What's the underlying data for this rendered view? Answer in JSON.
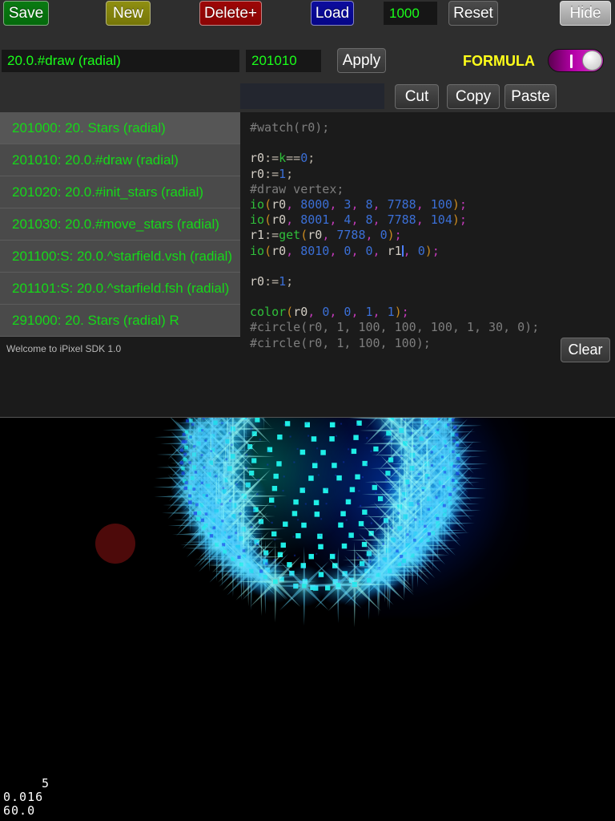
{
  "toolbar": {
    "save_label": "Save",
    "new_label": "New",
    "delete_label": "Delete+",
    "load_label": "Load",
    "count_value": "1000",
    "reset_label": "Reset",
    "hide_label": "Hide"
  },
  "edit_row": {
    "name_value": "20.0.#draw (radial)",
    "id_value": "201010",
    "apply_label": "Apply",
    "formula_label": "FORMULA",
    "formula_toggle_state": "on"
  },
  "clipboard_row": {
    "search_value": "",
    "search_placeholder": "",
    "cut_label": "Cut",
    "copy_label": "Copy",
    "paste_label": "Paste"
  },
  "list": {
    "items": [
      {
        "label": "201000: 20. Stars (radial)",
        "selected": true
      },
      {
        "label": "201010: 20.0.#draw (radial)",
        "selected": false
      },
      {
        "label": "201020: 20.0.#init_stars (radial)",
        "selected": false
      },
      {
        "label": "201030: 20.0.#move_stars (radial)",
        "selected": false
      },
      {
        "label": "201100:S: 20.0.^starfield.vsh (radial)",
        "selected": false
      },
      {
        "label": "201101:S: 20.0.^starfield.fsh (radial)",
        "selected": false
      },
      {
        "label": "291000: 20. Stars (radial) R",
        "selected": false
      }
    ]
  },
  "status": {
    "message": "Welcome to iPixel SDK 1.0",
    "clear_label": "Clear"
  },
  "editor": {
    "lines": [
      [
        {
          "t": "#watch(r0);",
          "c": "c-com"
        }
      ],
      [
        {
          "t": "",
          "c": "c-com"
        }
      ],
      [
        {
          "t": "r0",
          "c": "c-var"
        },
        {
          "t": ":=",
          "c": "c-op"
        },
        {
          "t": "k",
          "c": "c-fn"
        },
        {
          "t": "==",
          "c": "c-op"
        },
        {
          "t": "0",
          "c": "c-num"
        },
        {
          "t": ";",
          "c": "c-op"
        }
      ],
      [
        {
          "t": "r0",
          "c": "c-var"
        },
        {
          "t": ":=",
          "c": "c-op"
        },
        {
          "t": "1",
          "c": "c-num"
        },
        {
          "t": ";",
          "c": "c-op"
        }
      ],
      [
        {
          "t": "#draw vertex;",
          "c": "c-com"
        }
      ],
      [
        {
          "t": "io",
          "c": "c-fn"
        },
        {
          "t": "(",
          "c": "c-paren"
        },
        {
          "t": "r0",
          "c": "c-var"
        },
        {
          "t": ", ",
          "c": "c-comma"
        },
        {
          "t": "8000",
          "c": "c-num"
        },
        {
          "t": ", ",
          "c": "c-comma"
        },
        {
          "t": "3",
          "c": "c-num"
        },
        {
          "t": ", ",
          "c": "c-comma"
        },
        {
          "t": "8",
          "c": "c-num"
        },
        {
          "t": ", ",
          "c": "c-comma"
        },
        {
          "t": "7788",
          "c": "c-num"
        },
        {
          "t": ", ",
          "c": "c-comma"
        },
        {
          "t": "100",
          "c": "c-num"
        },
        {
          "t": ")",
          "c": "c-paren"
        },
        {
          "t": ";",
          "c": "c-comma"
        }
      ],
      [
        {
          "t": "io",
          "c": "c-fn"
        },
        {
          "t": "(",
          "c": "c-paren"
        },
        {
          "t": "r0",
          "c": "c-var"
        },
        {
          "t": ", ",
          "c": "c-comma"
        },
        {
          "t": "8001",
          "c": "c-num"
        },
        {
          "t": ", ",
          "c": "c-comma"
        },
        {
          "t": "4",
          "c": "c-num"
        },
        {
          "t": ", ",
          "c": "c-comma"
        },
        {
          "t": "8",
          "c": "c-num"
        },
        {
          "t": ", ",
          "c": "c-comma"
        },
        {
          "t": "7788",
          "c": "c-num"
        },
        {
          "t": ", ",
          "c": "c-comma"
        },
        {
          "t": "104",
          "c": "c-num"
        },
        {
          "t": ")",
          "c": "c-paren"
        },
        {
          "t": ";",
          "c": "c-comma"
        }
      ],
      [
        {
          "t": "r1",
          "c": "c-var"
        },
        {
          "t": ":=",
          "c": "c-op"
        },
        {
          "t": "get",
          "c": "c-fn"
        },
        {
          "t": "(",
          "c": "c-paren"
        },
        {
          "t": "r0",
          "c": "c-var"
        },
        {
          "t": ", ",
          "c": "c-comma"
        },
        {
          "t": "7788",
          "c": "c-num"
        },
        {
          "t": ", ",
          "c": "c-comma"
        },
        {
          "t": "0",
          "c": "c-num"
        },
        {
          "t": ")",
          "c": "c-paren"
        },
        {
          "t": ";",
          "c": "c-comma"
        }
      ],
      [
        {
          "t": "io",
          "c": "c-fn"
        },
        {
          "t": "(",
          "c": "c-paren"
        },
        {
          "t": "r0",
          "c": "c-var"
        },
        {
          "t": ", ",
          "c": "c-comma"
        },
        {
          "t": "8010",
          "c": "c-num"
        },
        {
          "t": ", ",
          "c": "c-comma"
        },
        {
          "t": "0",
          "c": "c-num"
        },
        {
          "t": ", ",
          "c": "c-comma"
        },
        {
          "t": "0",
          "c": "c-num"
        },
        {
          "t": ", ",
          "c": "c-comma"
        },
        {
          "t": "r1",
          "c": "c-var"
        },
        {
          "t": "|CARET|",
          "c": "caret"
        },
        {
          "t": ", ",
          "c": "c-comma"
        },
        {
          "t": "0",
          "c": "c-num"
        },
        {
          "t": ")",
          "c": "c-paren"
        },
        {
          "t": ";",
          "c": "c-comma"
        }
      ],
      [
        {
          "t": "",
          "c": "c-com"
        }
      ],
      [
        {
          "t": "r0",
          "c": "c-var"
        },
        {
          "t": ":=",
          "c": "c-op"
        },
        {
          "t": "1",
          "c": "c-num"
        },
        {
          "t": ";",
          "c": "c-op"
        }
      ],
      [
        {
          "t": "",
          "c": "c-com"
        }
      ],
      [
        {
          "t": "color",
          "c": "c-fn"
        },
        {
          "t": "(",
          "c": "c-paren"
        },
        {
          "t": "r0",
          "c": "c-var"
        },
        {
          "t": ", ",
          "c": "c-comma"
        },
        {
          "t": "0",
          "c": "c-num"
        },
        {
          "t": ", ",
          "c": "c-comma"
        },
        {
          "t": "0",
          "c": "c-num"
        },
        {
          "t": ", ",
          "c": "c-comma"
        },
        {
          "t": "1",
          "c": "c-num"
        },
        {
          "t": ", ",
          "c": "c-comma"
        },
        {
          "t": "1",
          "c": "c-num"
        },
        {
          "t": ")",
          "c": "c-paren"
        },
        {
          "t": ";",
          "c": "c-comma"
        }
      ],
      [
        {
          "t": "#circle(r0, 1, 100, 100, 100, 1, 30, 0);",
          "c": "c-com"
        }
      ],
      [
        {
          "t": "#circle(r0, 1, 100, 100);",
          "c": "c-com"
        }
      ]
    ]
  },
  "counters": {
    "line1": "5",
    "line2": "0.016",
    "line3": "60.0"
  },
  "colors": {
    "accent_green": "#16d819",
    "formula_yellow": "#ffff1a",
    "toggle_magenta": "#c41bb6",
    "circle_red": "#4d0a0a"
  }
}
